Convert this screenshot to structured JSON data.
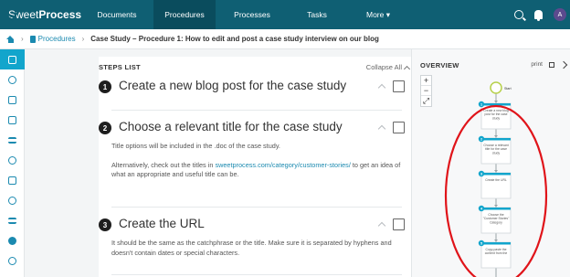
{
  "brand": {
    "name_light": "Sweet",
    "name_bold": "Process"
  },
  "nav": {
    "items": [
      {
        "label": "Documents",
        "w": 80
      },
      {
        "label": "Procedures",
        "w": 68,
        "active": true
      },
      {
        "label": "Processes",
        "w": 80
      },
      {
        "label": "Tasks",
        "w": 62
      },
      {
        "label": "More ▾",
        "w": 72
      }
    ],
    "avatar_initial": "A"
  },
  "breadcrumb": {
    "section": "Procedures",
    "current": "Case Study – Procedure 1: How to edit and post a case study interview on our blog"
  },
  "sidebar": {
    "icons": [
      "document-icon",
      "clock-icon",
      "thumbs-up-icon",
      "chat-icon",
      "list-icon",
      "umbrella-icon",
      "copy-icon",
      "team-icon",
      "signal-icon",
      "dot-icon",
      "settings-icon"
    ]
  },
  "steps": {
    "header": "STEPS LIST",
    "collapse_label": "Collapse All",
    "items": [
      {
        "number": "1",
        "title": "Create a new blog post for the case study"
      },
      {
        "number": "2",
        "title": "Choose a relevant title for the case study",
        "body_1": "Title options will be included in the .doc of the case study.",
        "body_2_pre": "Alternatively, check out the titles in ",
        "body_2_link": "sweetprocess.com/category/customer-stories/",
        "body_2_post": " to get an idea of what an appropriate and useful title can be."
      },
      {
        "number": "3",
        "title": "Create the URL",
        "body_1": "It should be the same as the catchphrase or the title. Make sure it is separated by hyphens and doesn't contain dates or special characters."
      }
    ]
  },
  "overview": {
    "title": "OVERVIEW",
    "print_label": "print",
    "zoom": [
      "+",
      "−",
      "⤢"
    ],
    "start_label": "Start",
    "nodes": [
      {
        "n": "1",
        "text": [
          "Create a new blog",
          "post for the case",
          "study"
        ]
      },
      {
        "n": "2",
        "text": [
          "Choose a relevant",
          "title for the case",
          "study"
        ]
      },
      {
        "n": "3",
        "text": [
          "Create the URL"
        ]
      },
      {
        "n": "4",
        "text": [
          "Choose the",
          "\"Customer Stories\"",
          "Category"
        ]
      },
      {
        "n": "5",
        "text": [
          "Copy-paste the",
          "content from the"
        ]
      }
    ],
    "highlight_color": "#e0141a"
  }
}
